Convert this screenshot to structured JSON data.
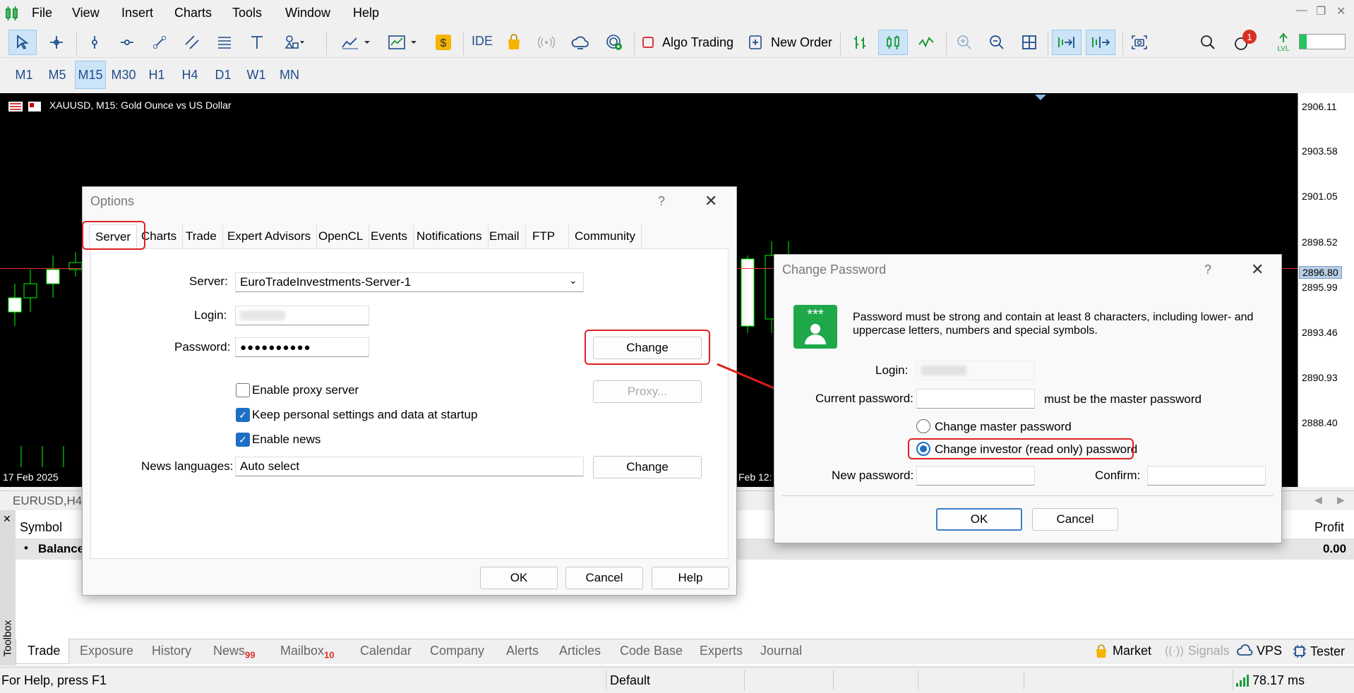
{
  "menu": [
    "File",
    "View",
    "Insert",
    "Charts",
    "Tools",
    "Window",
    "Help"
  ],
  "toolbar": {
    "ide": "IDE",
    "algo_trading": "Algo Trading",
    "new_order": "New Order",
    "notif_badge": "1"
  },
  "timeframes": [
    "M1",
    "M5",
    "M15",
    "M30",
    "H1",
    "H4",
    "D1",
    "W1",
    "MN"
  ],
  "active_timeframe": "M15",
  "chart": {
    "title": "XAUUSD, M15:  Gold Ounce vs US Dollar",
    "prices": [
      "2906.11",
      "2903.58",
      "2901.05",
      "2898.52",
      "2896.80",
      "2895.99",
      "2893.46",
      "2890.93",
      "2888.40"
    ],
    "current_price": "2896.80",
    "date_left": "17 Feb 2025",
    "date_mid": "Feb 12:",
    "colors": {
      "bull": "#00ff00",
      "bear": "#00ff00",
      "bg": "#000000",
      "current": "#ff0000"
    }
  },
  "chart_tab": "EURUSD,H4",
  "toolbox": {
    "side_label": "Toolbox",
    "symbol_header": "Symbol",
    "profit_header": "Profit",
    "balance_label": "Balance",
    "balance_profit": "0.00",
    "tabs": [
      {
        "label": "Trade",
        "badge": ""
      },
      {
        "label": "Exposure",
        "badge": ""
      },
      {
        "label": "History",
        "badge": ""
      },
      {
        "label": "News",
        "badge": "99"
      },
      {
        "label": "Mailbox",
        "badge": "10"
      },
      {
        "label": "Calendar",
        "badge": ""
      },
      {
        "label": "Company",
        "badge": ""
      },
      {
        "label": "Alerts",
        "badge": ""
      },
      {
        "label": "Articles",
        "badge": ""
      },
      {
        "label": "Code Base",
        "badge": ""
      },
      {
        "label": "Experts",
        "badge": ""
      },
      {
        "label": "Journal",
        "badge": ""
      }
    ],
    "right_items": {
      "market": "Market",
      "signals": "Signals",
      "vps": "VPS",
      "tester": "Tester"
    }
  },
  "status": {
    "help": "For Help, press F1",
    "profile": "Default",
    "ping": "78.17 ms"
  },
  "options_dialog": {
    "title": "Options",
    "help_q": "?",
    "tabs": [
      "Server",
      "Charts",
      "Trade",
      "Expert Advisors",
      "OpenCL",
      "Events",
      "Notifications",
      "Email",
      "FTP",
      "Community"
    ],
    "server_label": "Server:",
    "server_value": "EuroTradeInvestments-Server-1",
    "login_label": "Login:",
    "password_label": "Password:",
    "password_value": "●●●●●●●●●●",
    "change_label": "Change",
    "proxy_label": "Proxy...",
    "enable_proxy": "Enable proxy server",
    "keep_settings": "Keep personal settings and data at startup",
    "enable_news": "Enable news",
    "news_lang_label": "News languages:",
    "news_lang_value": "Auto select",
    "news_change": "Change",
    "ok": "OK",
    "cancel": "Cancel",
    "help": "Help"
  },
  "change_pw_dialog": {
    "title": "Change Password",
    "help_q": "?",
    "info": "Password must be strong and contain at least 8 characters, including lower- and uppercase letters, numbers and special symbols.",
    "login_label": "Login:",
    "current_label": "Current password:",
    "master_note": "must be the master password",
    "radio_master": "Change master password",
    "radio_investor": "Change investor (read only) password",
    "new_label": "New password:",
    "confirm_label": "Confirm:",
    "ok": "OK",
    "cancel": "Cancel"
  }
}
